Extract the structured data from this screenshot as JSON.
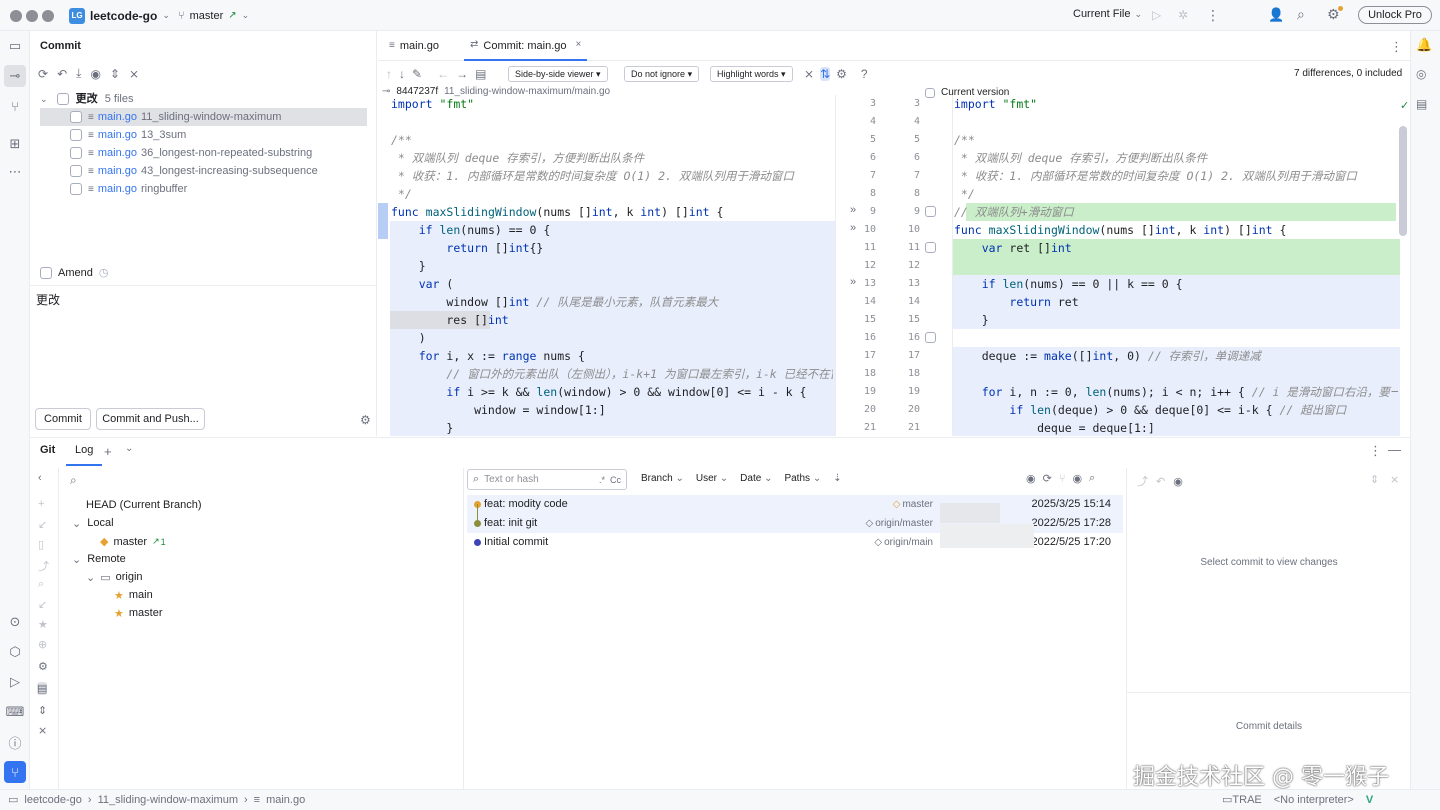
{
  "titlebar": {
    "project": "leetcode-go",
    "project_badge": "LG",
    "branch": "master",
    "run_config": "Current File",
    "unlock": "Unlock Pro"
  },
  "commit_panel": {
    "title": "Commit",
    "changes_label": "更改",
    "changes_count": "5 files",
    "files": [
      {
        "name": "main.go",
        "dir": "11_sliding-window-maximum"
      },
      {
        "name": "main.go",
        "dir": "13_3sum"
      },
      {
        "name": "main.go",
        "dir": "36_longest-non-repeated-substring"
      },
      {
        "name": "main.go",
        "dir": "43_longest-increasing-subsequence"
      },
      {
        "name": "main.go",
        "dir": "ringbuffer"
      }
    ],
    "amend_label": "Amend",
    "message": "更改",
    "commit_button": "Commit",
    "commit_push_button": "Commit and Push..."
  },
  "editor": {
    "tabs": [
      "main.go",
      "Commit: main.go"
    ],
    "viewer": "Side-by-side viewer",
    "ignore": "Do not ignore",
    "highlight": "Highlight words",
    "diff_summary": "7 differences, 0 included",
    "left_revision": "8447237f",
    "left_path": "11_sliding-window-maximum/main.go",
    "right_label": "Current version",
    "left_lines": [
      "3",
      "4",
      "5",
      "6",
      "7",
      "8",
      "9",
      "10",
      "11",
      "12",
      "13",
      "14",
      "15",
      "16",
      "17",
      "18",
      "19",
      "20",
      "21"
    ],
    "right_lines": [
      "3",
      "4",
      "5",
      "6",
      "7",
      "8",
      "9",
      "10",
      "11",
      "12",
      "13",
      "14",
      "15",
      "16",
      "17",
      "18",
      "19",
      "20",
      "21"
    ],
    "left_code": [
      "import \"fmt\"",
      "",
      "/**",
      " * 双端队列 deque 存索引，方便判断出队条件",
      " * 收获：1. 内部循环是常数的时间复杂度 O(1) 2. 双端队列用于滑动窗口",
      " */",
      "func maxSlidingWindow(nums []int, k int) []int {",
      "    if len(nums) == 0 {",
      "        return []int{}",
      "    }",
      "    var (",
      "        window []int // 队尾是最小元素，队首元素最大",
      "        res []int",
      "    )",
      "    for i, x := range nums {",
      "        // 窗口外的元素出队（左侧出），i-k+1 为窗口最左索引，i-k 已经不在窗口范",
      "        if i >= k && len(window) > 0 && window[0] <= i - k {",
      "            window = window[1:]",
      "        }"
    ],
    "right_code": [
      "import \"fmt\"",
      "",
      "/**",
      " * 双端队列 deque 存索引，方便判断出队条件",
      " * 收获：1. 内部循环是常数的时间复杂度 O(1) 2. 双端队列用于滑动窗口",
      " */",
      "// 双端队列+滑动窗口",
      "func maxSlidingWindow(nums []int, k int) []int {",
      "    var ret []int",
      "",
      "    if len(nums) == 0 || k == 0 {",
      "        return ret",
      "    }",
      "",
      "    deque := make([]int, 0) // 存索引，单调递减",
      "",
      "    for i, n := 0, len(nums); i < n; i++ { // i 是滑动窗口右沿，要一直移动到最",
      "        if len(deque) > 0 && deque[0] <= i-k { // 超出窗口",
      "            deque = deque[1:]"
    ]
  },
  "git_panel": {
    "tabs": [
      "Git",
      "Log"
    ],
    "search_placeholder": "Text or hash",
    "filters": [
      "Branch",
      "User",
      "Date",
      "Paths"
    ],
    "tree": {
      "head": "HEAD (Current Branch)",
      "local": "Local",
      "local_master": "master",
      "local_ahead": "1",
      "remote": "Remote",
      "origin": "origin",
      "origin_branches": [
        "main",
        "master"
      ]
    },
    "commits": [
      {
        "message": "feat: modity code",
        "ref": "master",
        "date": "2025/3/25 15:14"
      },
      {
        "message": "feat: init git",
        "ref": "origin/master",
        "date": "2022/5/25 17:28"
      },
      {
        "message": "Initial commit",
        "ref": "origin/main",
        "date": "2022/5/25 17:20"
      }
    ],
    "select_hint": "Select commit to view changes",
    "details_label": "Commit details"
  },
  "watermark": "掘金技术社区 @ 零一猴子",
  "statusbar": {
    "crumbs": [
      "leetcode-go",
      "11_sliding-window-maximum",
      "main.go"
    ],
    "trae": "TRAE",
    "interpreter": "<No interpreter>"
  },
  "colors": {
    "accent": "#3574f0",
    "added": "#c9eec9",
    "modified": "#dae4f8",
    "changed_text": "#b8cdf5"
  }
}
